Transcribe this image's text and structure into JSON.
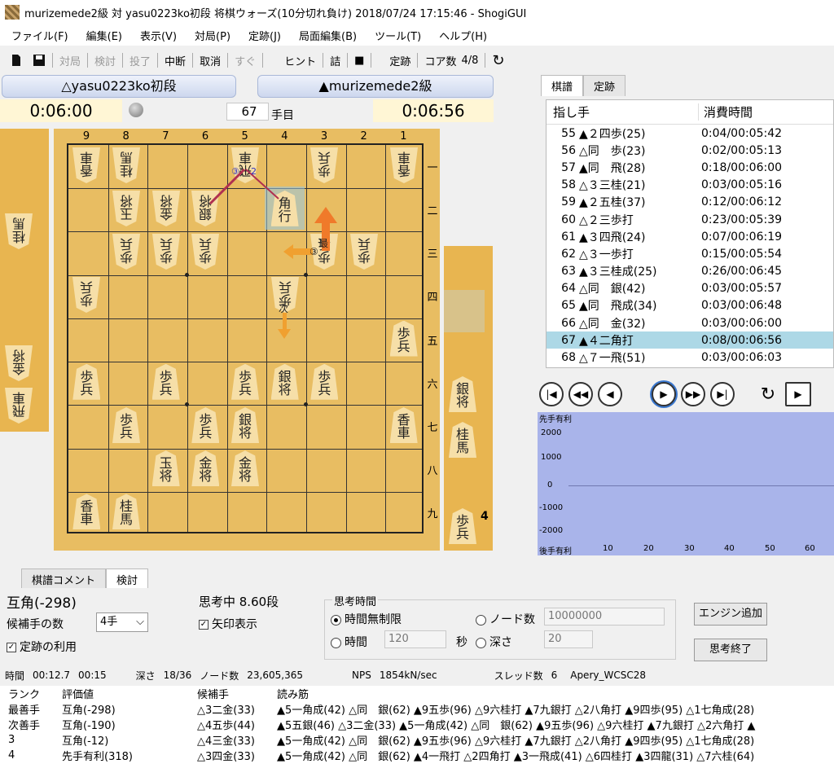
{
  "window": {
    "title": "murizemede2級 対 yasu0223ko初段 将棋ウォーズ(10分切れ負け) 2018/07/24 17:15:46 - ShogiGUI"
  },
  "menu": [
    "ファイル(F)",
    "編集(E)",
    "表示(V)",
    "対局(P)",
    "定跡(J)",
    "局面編集(B)",
    "ツール(T)",
    "ヘルプ(H)"
  ],
  "toolbar": {
    "taikyoku": "対局",
    "kento": "検討",
    "toryo": "投了",
    "chudan": "中断",
    "torikeshi": "取消",
    "sugu": "すぐ",
    "hint": "ヒント",
    "tsume": "詰",
    "joseki": "定跡",
    "core_label": "コア数",
    "core_value": "4/8"
  },
  "players": {
    "gote_name": "△yasu0223ko初段",
    "sente_name": "▲murizemede2級",
    "gote_time": "0:06:00",
    "sente_time": "0:06:56",
    "move_no": "67",
    "move_suffix": "手目"
  },
  "board": {
    "files": [
      "9",
      "8",
      "7",
      "6",
      "5",
      "4",
      "3",
      "2",
      "1"
    ],
    "ranks": [
      "一",
      "二",
      "三",
      "四",
      "五",
      "六",
      "七",
      "八",
      "九"
    ],
    "annotations": {
      "best": "最",
      "next": "次",
      "n3": "③",
      "n2": "2"
    },
    "gote_pieces": [
      {
        "f": 9,
        "r": 1,
        "t": "香車"
      },
      {
        "f": 8,
        "r": 1,
        "t": "桂馬"
      },
      {
        "f": 5,
        "r": 1,
        "t": "飛車"
      },
      {
        "f": 3,
        "r": 1,
        "t": "歩兵"
      },
      {
        "f": 1,
        "r": 1,
        "t": "香車"
      },
      {
        "f": 8,
        "r": 2,
        "t": "玉将"
      },
      {
        "f": 7,
        "r": 2,
        "t": "金将"
      },
      {
        "f": 6,
        "r": 2,
        "t": "銀将"
      },
      {
        "f": 8,
        "r": 3,
        "t": "歩兵"
      },
      {
        "f": 7,
        "r": 3,
        "t": "歩兵"
      },
      {
        "f": 6,
        "r": 3,
        "t": "歩兵"
      },
      {
        "f": 3,
        "r": 3,
        "t": "歩兵"
      },
      {
        "f": 2,
        "r": 3,
        "t": "歩兵"
      },
      {
        "f": 9,
        "r": 4,
        "t": "歩兵"
      },
      {
        "f": 4,
        "r": 4,
        "t": "歩兵"
      }
    ],
    "sente_pieces": [
      {
        "f": 4,
        "r": 2,
        "t": "角行"
      },
      {
        "f": 1,
        "r": 5,
        "t": "歩兵"
      },
      {
        "f": 9,
        "r": 6,
        "t": "歩兵"
      },
      {
        "f": 7,
        "r": 6,
        "t": "歩兵"
      },
      {
        "f": 5,
        "r": 6,
        "t": "歩兵"
      },
      {
        "f": 4,
        "r": 6,
        "t": "銀将"
      },
      {
        "f": 3,
        "r": 6,
        "t": "歩兵"
      },
      {
        "f": 8,
        "r": 7,
        "t": "歩兵"
      },
      {
        "f": 6,
        "r": 7,
        "t": "歩兵"
      },
      {
        "f": 5,
        "r": 7,
        "t": "銀将"
      },
      {
        "f": 1,
        "r": 7,
        "t": "香車"
      },
      {
        "f": 7,
        "r": 8,
        "t": "玉将"
      },
      {
        "f": 6,
        "r": 8,
        "t": "金将"
      },
      {
        "f": 5,
        "r": 8,
        "t": "金将"
      },
      {
        "f": 9,
        "r": 9,
        "t": "香車"
      },
      {
        "f": 8,
        "r": 9,
        "t": "桂馬"
      }
    ],
    "gote_hand": [
      "桂馬",
      "金将",
      "飛車"
    ],
    "sente_hand": [
      "銀将",
      "桂馬",
      "歩兵"
    ],
    "sente_hand_count": "4"
  },
  "kifu": {
    "tabs": [
      "棋譜",
      "定跡"
    ],
    "headers": [
      "指し手",
      "消費時間"
    ],
    "rows": [
      [
        "55",
        "▲２四歩(25)",
        "0:04/00:05:42"
      ],
      [
        "56",
        "△同　歩(23)",
        "0:02/00:05:13"
      ],
      [
        "57",
        "▲同　飛(28)",
        "0:18/00:06:00"
      ],
      [
        "58",
        "△３三桂(21)",
        "0:03/00:05:16"
      ],
      [
        "59",
        "▲２五桂(37)",
        "0:12/00:06:12"
      ],
      [
        "60",
        "△２三歩打",
        "0:23/00:05:39"
      ],
      [
        "61",
        "▲３四飛(24)",
        "0:07/00:06:19"
      ],
      [
        "62",
        "△３一歩打",
        "0:15/00:05:54"
      ],
      [
        "63",
        "▲３三桂成(25)",
        "0:26/00:06:45"
      ],
      [
        "64",
        "△同　銀(42)",
        "0:03/00:05:57"
      ],
      [
        "65",
        "▲同　飛成(34)",
        "0:03/00:06:48"
      ],
      [
        "66",
        "△同　金(32)",
        "0:03/00:06:00"
      ],
      [
        "67",
        "▲４二角打",
        "0:08/00:06:56"
      ],
      [
        "68",
        "△７一飛(51)",
        "0:03/00:06:03"
      ]
    ],
    "selected_index": 12
  },
  "graph": {
    "top_label": "先手有利",
    "bottom_label": "後手有利",
    "y_ticks": [
      "2000",
      "1000",
      "0",
      "-1000",
      "-2000"
    ],
    "x_ticks": [
      "10",
      "20",
      "30",
      "40",
      "50",
      "60"
    ]
  },
  "bottom_tabs": [
    "棋譜コメント",
    "検討"
  ],
  "analysis": {
    "eval_text": "互角(-298)",
    "thinking": "思考中 8.60段",
    "candidates_label": "候補手の数",
    "candidates_value": "4手",
    "use_joseki": "定跡の利用",
    "show_arrows": "矢印表示",
    "think_time_title": "思考時間",
    "unlimited": "時間無制限",
    "time_label": "時間",
    "time_value": "120",
    "sec_label": "秒",
    "node_label": "ノード数",
    "node_value": "10000000",
    "depth_label": "深さ",
    "depth_value": "20",
    "add_engine": "エンジン追加",
    "stop_think": "思考終了"
  },
  "stats": {
    "time_label": "時間",
    "time1": "00:12.7",
    "time2": "00:15",
    "depth_label": "深さ",
    "depth": "18/36",
    "nodes_label": "ノード数",
    "nodes": "23,605,365",
    "nps_label": "NPS",
    "nps": "1854kN/sec",
    "threads_label": "スレッド数",
    "threads": "6",
    "engine": "Apery_WCSC28"
  },
  "pv": {
    "headers": [
      "ランク",
      "評価値",
      "候補手",
      "読み筋"
    ],
    "rows": [
      [
        "最善手",
        "互角(-298)",
        "△3二金(33)",
        "▲5一角成(42) △同　銀(62) ▲9五歩(96) △9六桂打 ▲7九銀打 △2八角打 ▲9四歩(95) △1七角成(28)"
      ],
      [
        "次善手",
        "互角(-190)",
        "△4五歩(44)",
        "▲5五銀(46) △3二金(33) ▲5一角成(42) △同　銀(62) ▲9五歩(96) △9六桂打 ▲7九銀打 △2六角打 ▲"
      ],
      [
        "3",
        "互角(-12)",
        "△4三金(33)",
        "▲5一角成(42) △同　銀(62) ▲9五歩(96) △9六桂打 ▲7九銀打 △2八角打 ▲9四歩(95) △1七角成(28)"
      ],
      [
        "4",
        "先手有利(318)",
        "△3四金(33)",
        "▲5一角成(42) △同　銀(62) ▲4一飛打 △2四角打 ▲3一飛成(41) △6四桂打 ▲3四龍(31) △7六桂(64)"
      ]
    ]
  }
}
